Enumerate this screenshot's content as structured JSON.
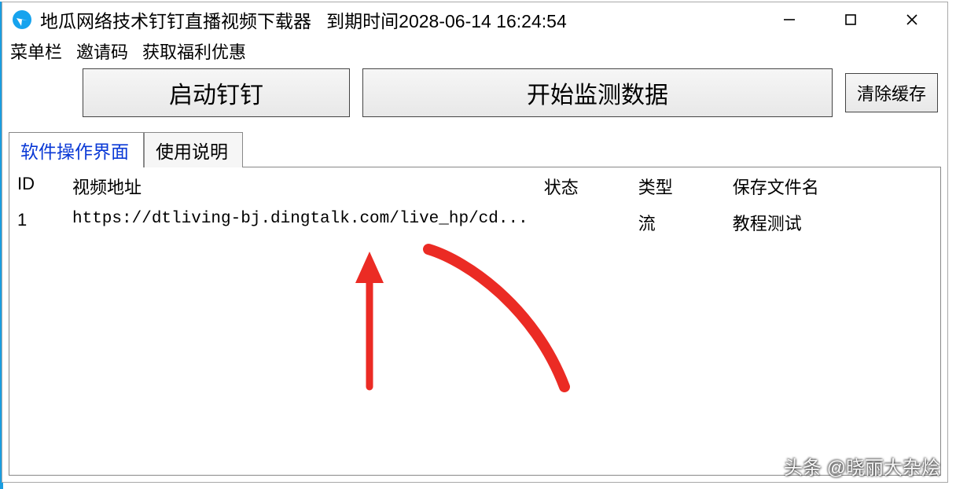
{
  "titlebar": {
    "app_name": "地瓜网络技术钉钉直播视频下载器",
    "expiry_prefix": "到期时间",
    "expiry_value": "2028-06-14 16:24:54"
  },
  "menubar": {
    "items": [
      "菜单栏",
      "邀请码",
      "获取福利优惠"
    ]
  },
  "actions": {
    "launch_label": "启动钉钉",
    "monitor_label": "开始监测数据",
    "clear_cache_label": "清除缓存"
  },
  "tabs": {
    "active_label": "软件操作界面",
    "inactive_label": "使用说明"
  },
  "table": {
    "headers": {
      "id": "ID",
      "url": "视频地址",
      "status": "状态",
      "type": "类型",
      "filename": "保存文件名"
    },
    "rows": [
      {
        "id": "1",
        "url": "https://dtliving-bj.dingtalk.com/live_hp/cd...",
        "status": "",
        "type": "流",
        "filename": "教程测试"
      }
    ]
  },
  "watermark": "头条 @晓丽大杂烩"
}
